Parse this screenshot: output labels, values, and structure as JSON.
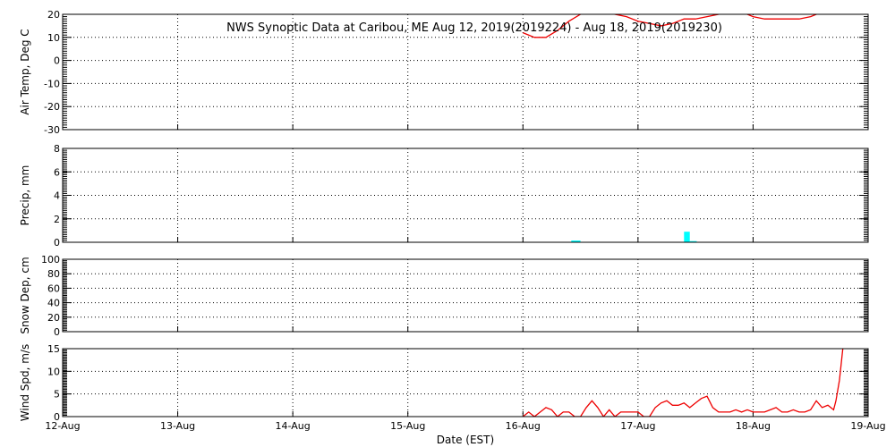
{
  "chart_data": {
    "type": "line",
    "title": "NWS Synoptic Data at Caribou, ME   Aug 12, 2019(2019224) - Aug 18, 2019(2019230)",
    "xlabel": "Date (EST)",
    "x_ticks": [
      "12-Aug",
      "13-Aug",
      "14-Aug",
      "15-Aug",
      "16-Aug",
      "17-Aug",
      "18-Aug",
      "19-Aug"
    ],
    "x_range_days": [
      0,
      7
    ],
    "grid": true,
    "colors": {
      "line": "#ee0000",
      "bar": "#00ffff",
      "axis": "#000000"
    },
    "panels": [
      {
        "id": "airtemp",
        "type": "line",
        "ylabel": "Air Temp, Deg C",
        "ylim": [
          -30,
          20
        ],
        "yticks": [
          20,
          10,
          0,
          -10,
          -20,
          -30
        ],
        "series": [
          {
            "x": [
              4.0,
              4.1,
              4.2,
              4.3,
              4.4,
              4.5,
              4.6,
              4.7,
              4.8,
              4.9,
              5.0,
              5.1,
              5.2,
              5.3,
              5.4,
              5.5,
              5.6,
              5.7,
              5.8,
              5.9,
              6.0,
              6.1,
              6.2,
              6.3,
              6.4,
              6.5,
              6.6,
              6.7
            ],
            "values": [
              12,
              10,
              10,
              13,
              17,
              20,
              23,
              21,
              20,
              19,
              17,
              16,
              15,
              16,
              18,
              18,
              19,
              20,
              21,
              21,
              19,
              18,
              18,
              18,
              18,
              19,
              21,
              23
            ]
          }
        ]
      },
      {
        "id": "precip",
        "type": "bar",
        "ylabel": "Precip, mm",
        "ylim": [
          0,
          8
        ],
        "yticks": [
          8,
          6,
          4,
          2,
          0
        ],
        "bars": [
          {
            "x": 4.42,
            "width": 0.08,
            "value": 0.15
          },
          {
            "x": 5.4,
            "width": 0.05,
            "value": 0.9
          },
          {
            "x": 5.45,
            "width": 0.06,
            "value": 0.1
          }
        ]
      },
      {
        "id": "snowdep",
        "type": "line",
        "ylabel": "Snow Dep, cm",
        "ylim": [
          0,
          100
        ],
        "yticks": [
          100,
          80,
          60,
          40,
          20,
          0
        ],
        "series": []
      },
      {
        "id": "windspd",
        "type": "line",
        "ylabel": "Wind Spd, m/s",
        "ylim": [
          0,
          15
        ],
        "yticks": [
          15,
          10,
          5,
          0
        ],
        "series": [
          {
            "x": [
              4.0,
              4.05,
              4.1,
              4.15,
              4.2,
              4.25,
              4.3,
              4.35,
              4.4,
              4.45,
              4.5,
              4.55,
              4.6,
              4.65,
              4.7,
              4.75,
              4.8,
              4.85,
              4.9,
              4.95,
              5.0,
              5.05,
              5.1,
              5.15,
              5.2,
              5.25,
              5.3,
              5.35,
              5.4,
              5.45,
              5.5,
              5.55,
              5.6,
              5.65,
              5.7,
              5.75,
              5.8,
              5.85,
              5.9,
              5.95,
              6.0,
              6.05,
              6.1,
              6.15,
              6.2,
              6.25,
              6.3,
              6.35,
              6.4,
              6.45,
              6.5,
              6.55,
              6.6,
              6.65,
              6.7,
              6.72,
              6.75,
              6.78
            ],
            "values": [
              0,
              1,
              0,
              1,
              2,
              1.5,
              0,
              1,
              1,
              0,
              0,
              2,
              3.5,
              2,
              0,
              1.5,
              0,
              1,
              1,
              1,
              1,
              0,
              0,
              2,
              3,
              3.5,
              2.5,
              2.5,
              3,
              2,
              3,
              4,
              4.5,
              2,
              1,
              1,
              1,
              1.5,
              1,
              1.5,
              1,
              1,
              1,
              1.5,
              2,
              1,
              1,
              1.5,
              1,
              1,
              1.5,
              3.5,
              2,
              2.5,
              1.5,
              3.5,
              8,
              15
            ]
          }
        ]
      }
    ]
  }
}
